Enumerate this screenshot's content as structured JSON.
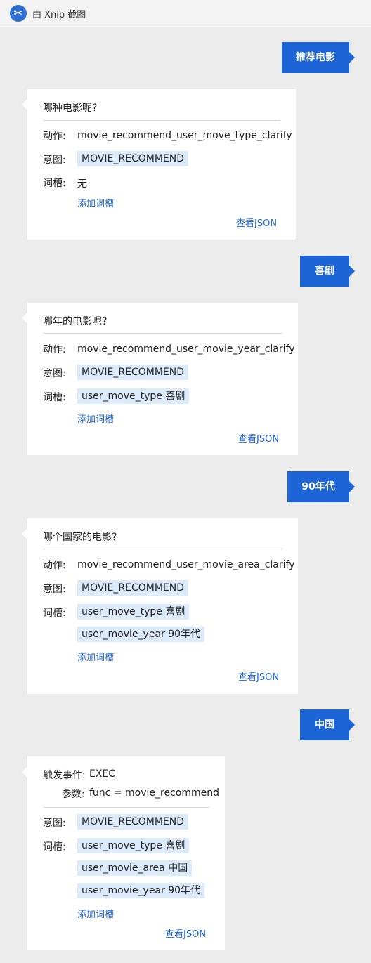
{
  "app": {
    "title": "由 Xnip 截图"
  },
  "messages": {
    "user1": "推荐电影",
    "user2": "喜剧",
    "user3": "90年代",
    "user4": "中国"
  },
  "labels": {
    "action": "动作:",
    "intent": "意图:",
    "slots": "词槽:",
    "add_slot": "添加词槽",
    "view_json": "查看JSON",
    "trigger": "触发事件:",
    "params": "参数:"
  },
  "cards": [
    {
      "question": "哪种电影呢?",
      "action": "movie_recommend_user_move_type_clarify",
      "intent": "MOVIE_RECOMMEND",
      "slot_none": "无"
    },
    {
      "question": "哪年的电影呢?",
      "action": "movie_recommend_user_movie_year_clarify",
      "intent": "MOVIE_RECOMMEND",
      "slots": [
        "user_move_type 喜剧"
      ]
    },
    {
      "question": "哪个国家的电影?",
      "action": "movie_recommend_user_movie_area_clarify",
      "intent": "MOVIE_RECOMMEND",
      "slots": [
        "user_move_type 喜剧",
        "user_movie_year 90年代"
      ]
    },
    {
      "trigger": "EXEC",
      "params": "func = movie_recommend",
      "intent": "MOVIE_RECOMMEND",
      "slots": [
        "user_move_type 喜剧",
        "user_movie_area 中国",
        "user_movie_year 90年代"
      ]
    }
  ],
  "colors": {
    "accent": "#1d64d6",
    "tag_bg": "#dcebfb",
    "background": "#ececec"
  }
}
